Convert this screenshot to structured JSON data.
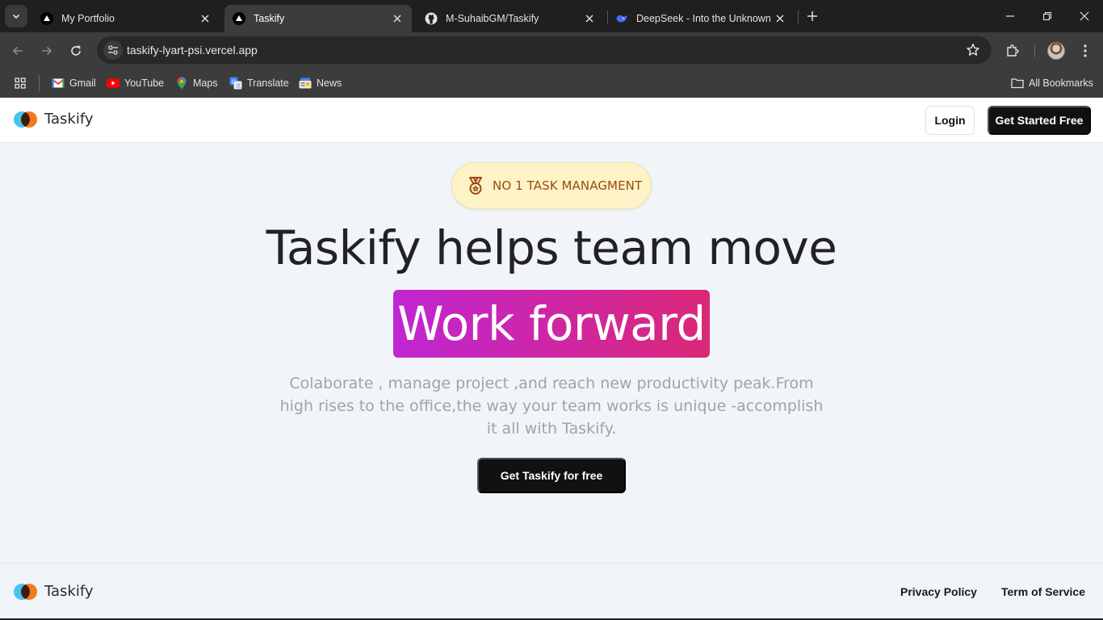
{
  "browser": {
    "tabs": [
      {
        "label": "My Portfolio",
        "favicon": "vercel-triangle-icon",
        "active": false
      },
      {
        "label": "Taskify",
        "favicon": "vercel-triangle-icon",
        "active": true
      },
      {
        "label": "M-SuhaibGM/Taskify",
        "favicon": "github-icon",
        "active": false
      },
      {
        "label": "DeepSeek - Into the Unknown",
        "favicon": "deepseek-whale-icon",
        "active": false
      }
    ],
    "url": "taskify-lyart-psi.vercel.app",
    "bookmarks": [
      {
        "label": "Gmail",
        "icon": "gmail-icon"
      },
      {
        "label": "YouTube",
        "icon": "youtube-icon"
      },
      {
        "label": "Maps",
        "icon": "maps-pin-icon"
      },
      {
        "label": "Translate",
        "icon": "translate-icon"
      },
      {
        "label": "News",
        "icon": "news-icon"
      }
    ],
    "all_bookmarks": "All Bookmarks"
  },
  "site": {
    "logo_text": "Taskify",
    "nav": {
      "login": "Login",
      "get_started": "Get Started Free"
    },
    "hero": {
      "badge": "NO 1 TASK MANAGMENT",
      "title": "Taskify helps team move",
      "highlight": "Work forward",
      "subtitle": "Colaborate , manage project ,and reach new productivity peak.From high rises to the office,the way your team works is unique -accomplish it all with Taskify.",
      "cta": "Get Taskify for free"
    },
    "footer": {
      "logo_text": "Taskify",
      "privacy": "Privacy Policy",
      "terms": "Term of Service"
    }
  },
  "colors": {
    "highlight_start": "#c026d3",
    "highlight_end": "#db2777",
    "badge_bg": "#fdf3c7",
    "badge_text": "#9a4a12",
    "primary_button": "#111111",
    "page_bg": "#f1f4f9"
  }
}
